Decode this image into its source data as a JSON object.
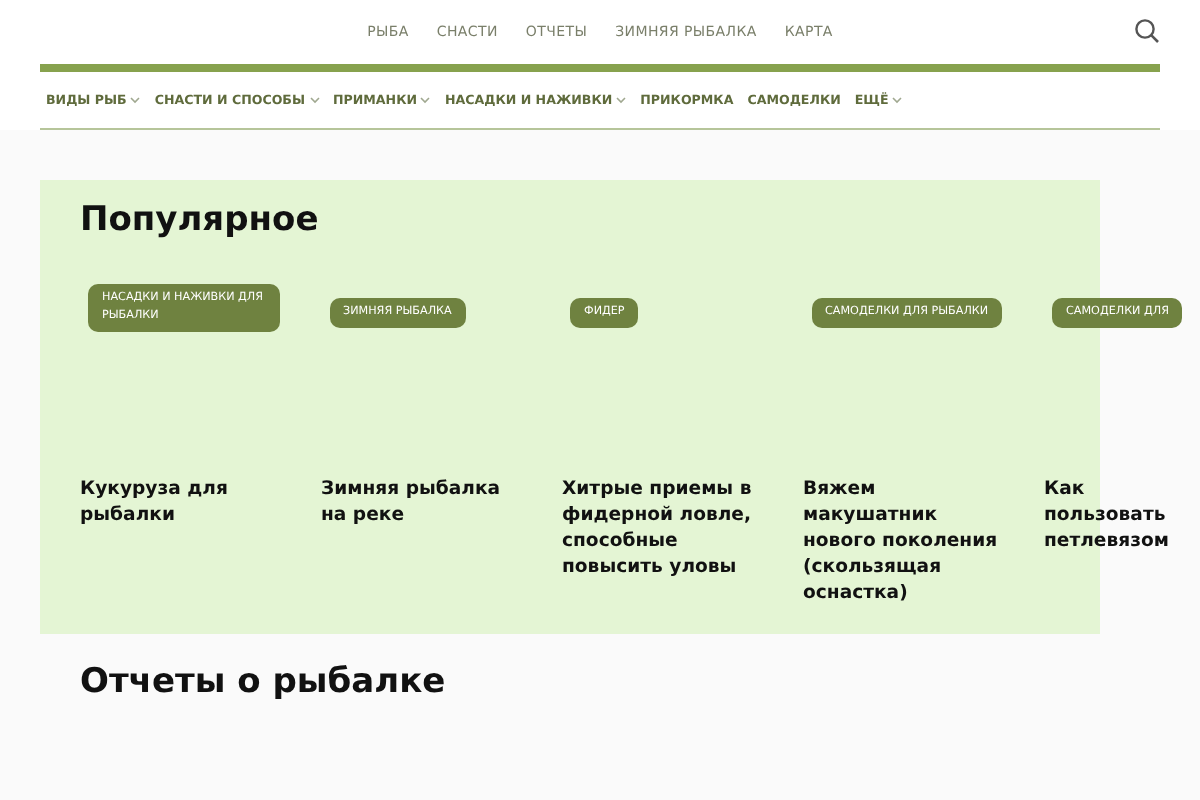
{
  "top_menu": [
    "РЫБА",
    "СНАСТИ",
    "ОТЧЕТЫ",
    "ЗИМНЯЯ РЫБАЛКА",
    "КАРТА"
  ],
  "sub_menu": [
    {
      "label": "ВИДЫ РЫБ",
      "has_dropdown": true
    },
    {
      "label": "СНАСТИ И СПОСОБЫ",
      "has_dropdown": true
    },
    {
      "label": "ПРИМАНКИ",
      "has_dropdown": true
    },
    {
      "label": "НАСАДКИ И НАЖИВКИ",
      "has_dropdown": true
    },
    {
      "label": "ПРИКОРМКА",
      "has_dropdown": false
    },
    {
      "label": "САМОДЕЛКИ",
      "has_dropdown": false
    },
    {
      "label": "ЕЩЁ",
      "has_dropdown": true
    }
  ],
  "popular": {
    "title": "Популярное",
    "cards": [
      {
        "tag": "НАСАДКИ И НАЖИВКИ ДЛЯ РЫБАЛКИ",
        "title": "Кукуруза для рыбалки"
      },
      {
        "tag": "ЗИМНЯЯ РЫБАЛКА",
        "title": "Зимняя рыбалка на реке"
      },
      {
        "tag": "ФИДЕР",
        "title": "Хитрые приемы в фидерной ловле, способные повысить уловы"
      },
      {
        "tag": "САМОДЕЛКИ ДЛЯ РЫБАЛКИ",
        "title": "Вяжем макушатник нового поколения (скользящая оснастка)"
      },
      {
        "tag": "САМОДЕЛКИ ДЛЯ",
        "title": "Как пользовать петлевязом"
      }
    ]
  },
  "reports": {
    "title": "Отчеты о рыбалке"
  }
}
